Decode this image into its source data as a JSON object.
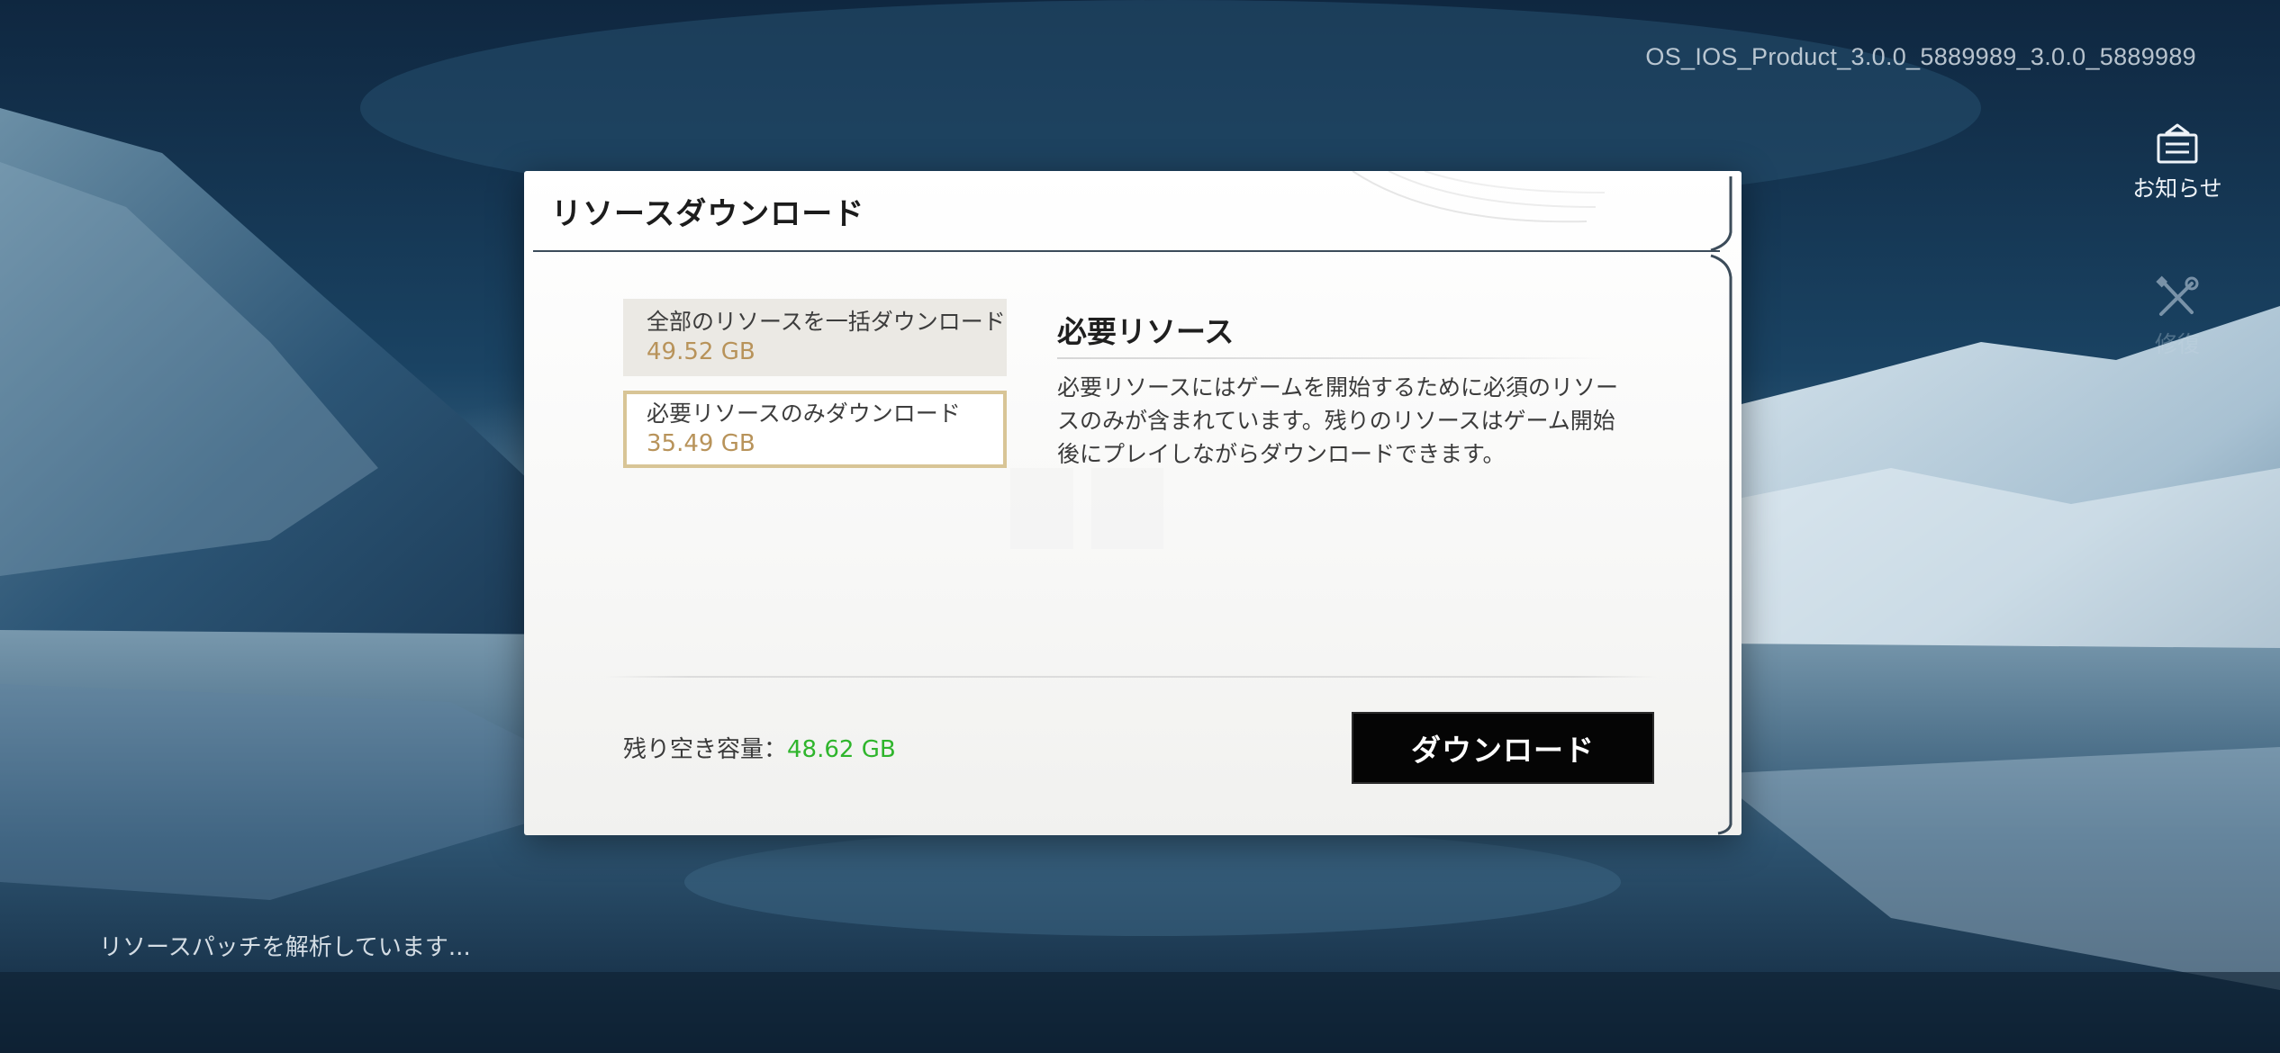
{
  "build": {
    "version": "OS_IOS_Product_3.0.0_5889989_3.0.0_5889989"
  },
  "side_buttons": {
    "notice_label": "お知らせ",
    "repair_label": "修復"
  },
  "dialog": {
    "title": "リソースダウンロード",
    "options": [
      {
        "label": "全部のリソースを一括ダウンロード",
        "size": "49.52 GB",
        "selected": false
      },
      {
        "label": "必要リソースのみダウンロード",
        "size": "35.49 GB",
        "selected": true
      }
    ],
    "description": {
      "title": "必要リソース",
      "text": "必要リソースにはゲームを開始するために必須のリソースのみが含まれています。残りのリソースはゲーム開始後にプレイしながらダウンロードできます。"
    },
    "storage": {
      "label": "残り空き容量：",
      "value": "48.62 GB"
    },
    "download_button": "ダウンロード"
  },
  "status": {
    "message": "リソースパッチを解析しています..."
  },
  "colors": {
    "size_gold": "#b8935a",
    "storage_green": "#2fb52c",
    "selected_border": "#d8c596",
    "button_black": "#050505"
  },
  "icons": {
    "notice": "notice-tray-icon",
    "repair": "wrench-screwdriver-icon"
  }
}
